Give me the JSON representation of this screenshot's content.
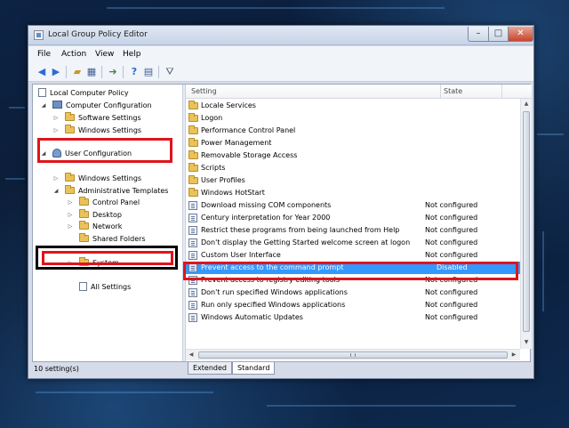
{
  "window": {
    "title": "Local Group Policy Editor",
    "controls": {
      "minimize": "–",
      "maximize": "□",
      "close": "✕"
    }
  },
  "menu": [
    "File",
    "Action",
    "View",
    "Help"
  ],
  "toolbar_icons": [
    "back-arrow-icon",
    "forward-arrow-icon",
    "up-folder-icon",
    "show-hide-tree-icon",
    "export-list-icon",
    "help-icon",
    "properties-icon",
    "filter-icon"
  ],
  "tree": {
    "root": "Local Computer Policy",
    "computer_configuration": "Computer Configuration",
    "software_settings_1": "Software Settings",
    "windows_settings_1": "Windows Settings",
    "user_configuration": "User Configuration",
    "windows_settings_2": "Windows Settings",
    "administrative_templates": "Administrative Templates",
    "control_panel": "Control Panel",
    "desktop": "Desktop",
    "network": "Network",
    "shared_folders": "Shared Folders",
    "system": "System",
    "all_settings": "All Settings"
  },
  "list": {
    "columns": {
      "setting": "Setting",
      "state": "State"
    },
    "folders": [
      "Locale Services",
      "Logon",
      "Performance Control Panel",
      "Power Management",
      "Removable Storage Access",
      "Scripts",
      "User Profiles",
      "Windows HotStart"
    ],
    "settings": [
      {
        "name": "Download missing COM components",
        "state": "Not configured"
      },
      {
        "name": "Century interpretation for Year 2000",
        "state": "Not configured"
      },
      {
        "name": "Restrict these programs from being launched from Help",
        "state": "Not configured"
      },
      {
        "name": "Don't display the Getting Started welcome screen at logon",
        "state": "Not configured"
      },
      {
        "name": "Custom User Interface",
        "state": "Not configured"
      },
      {
        "name": "Prevent access to the command prompt",
        "state": "Disabled"
      },
      {
        "name": "Prevent access to registry editing tools",
        "state": "Not configured"
      },
      {
        "name": "Don't run specified Windows applications",
        "state": "Not configured"
      },
      {
        "name": "Run only specified Windows applications",
        "state": "Not configured"
      },
      {
        "name": "Windows Automatic Updates",
        "state": "Not configured"
      }
    ],
    "selected_setting": "Prevent access to the command prompt"
  },
  "tabs": {
    "extended": "Extended",
    "standard": "Standard",
    "active": "Standard"
  },
  "status": "10 setting(s)",
  "colors": {
    "selection": "#3399ff",
    "highlight_red": "#e0141b",
    "highlight_black": "#000000"
  }
}
